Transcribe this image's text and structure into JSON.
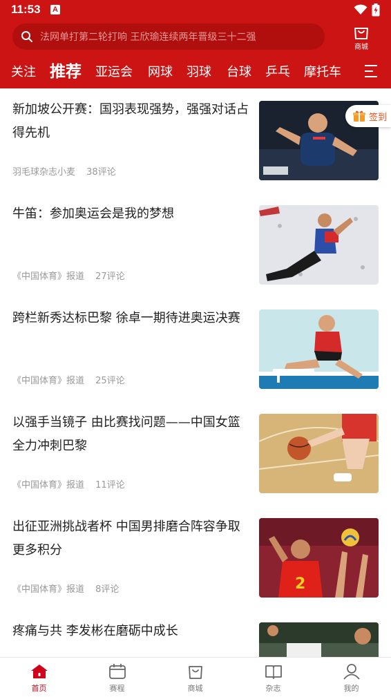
{
  "status": {
    "time": "11:53",
    "notification_letter": "A"
  },
  "search": {
    "placeholder": "法网单打第二轮打响 王欣瑜连续两年晋级三十二强"
  },
  "mall": {
    "label": "商城"
  },
  "categories": [
    "关注",
    "推荐",
    "亚运会",
    "网球",
    "羽球",
    "台球",
    "乒乓",
    "摩托车"
  ],
  "active_category": "推荐",
  "signin": {
    "label": "签到"
  },
  "feed": [
    {
      "title": "新加坡公开赛：国羽表现强势，强强对话占得先机",
      "source": "羽毛球杂志小麦",
      "comments": "38评论"
    },
    {
      "title": "牛笛：参加奥运会是我的梦想",
      "source": "《中国体育》报道",
      "comments": "27评论"
    },
    {
      "title": "跨栏新秀达标巴黎 徐卓一期待进奥运决赛",
      "source": "《中国体育》报道",
      "comments": "25评论"
    },
    {
      "title": "以强手当镜子 由比赛找问题——中国女篮全力冲刺巴黎",
      "source": "《中国体育》报道",
      "comments": "11评论"
    },
    {
      "title": "出征亚洲挑战者杯 中国男排磨合阵容争取更多积分",
      "source": "《中国体育》报道",
      "comments": "8评论"
    },
    {
      "title": "疼痛与共 李发彬在磨砺中成长",
      "source": "",
      "comments": ""
    }
  ],
  "bottom_nav": [
    {
      "label": "首页",
      "icon": "home-icon",
      "active": true
    },
    {
      "label": "赛程",
      "icon": "calendar-icon",
      "active": false
    },
    {
      "label": "商城",
      "icon": "shopping-bag-icon",
      "active": false
    },
    {
      "label": "杂志",
      "icon": "magazine-icon",
      "active": false
    },
    {
      "label": "我的",
      "icon": "profile-icon",
      "active": false
    }
  ],
  "colors": {
    "brand_red": "#cc1414",
    "active_nav": "#d0021b",
    "signin_orange": "#e8531b"
  }
}
